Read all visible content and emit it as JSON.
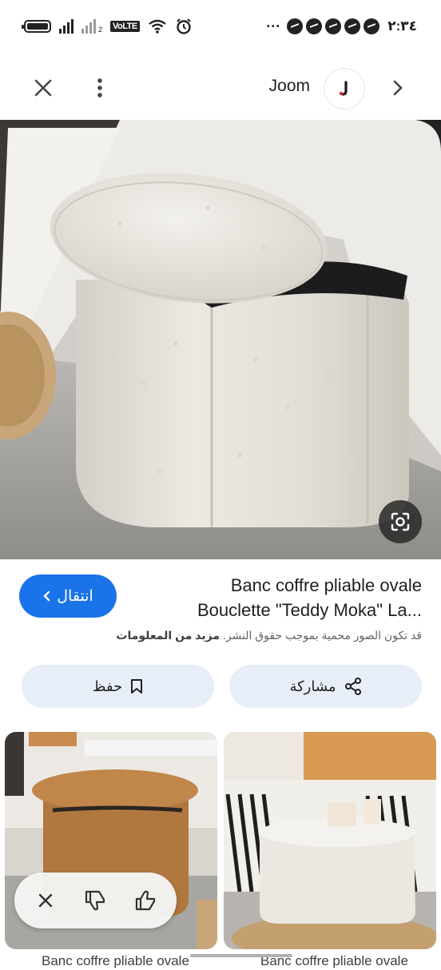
{
  "status_bar": {
    "time": "٢:٣٤",
    "dots": "···",
    "network_badge": "VoLTE",
    "sim_label": "2"
  },
  "header": {
    "brand": "Joom"
  },
  "product": {
    "title_line1": "Banc coffre pliable ovale",
    "title_line2": "Bouclette \"Teddy Moka\" La...",
    "copyright_text": "قد تكون الصور محمية بموجب حقوق النشر.",
    "more_info_label": "مزيد من المعلومات"
  },
  "actions": {
    "visit_label": "انتقال",
    "share_label": "مشاركة",
    "save_label": "حفظ"
  },
  "related": [
    {
      "caption": "Banc coffre pliable ovale"
    },
    {
      "caption": "Banc coffre pliable ovale"
    }
  ],
  "colors": {
    "accent": "#1a73e8",
    "pill_bg": "#e8eef8",
    "brand_logo_accent": "#e0302f"
  }
}
